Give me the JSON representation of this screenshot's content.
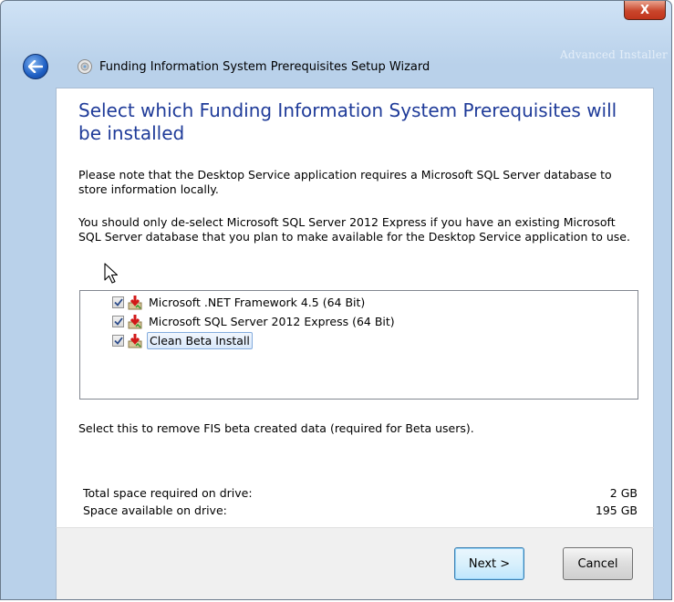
{
  "titlebar": {
    "close_glyph": "X",
    "brand_text": "Advanced Installer",
    "title": "Funding Information System Prerequisites Setup Wizard"
  },
  "icons": {
    "back": "back-arrow-icon",
    "wizard": "setup-wizard-icon",
    "close": "close-icon",
    "package": "install-package-icon",
    "checkbox": "checkbox-checked-icon",
    "cursor": "mouse-pointer-icon"
  },
  "page": {
    "heading": "Select which Funding Information System Prerequisites will be installed",
    "paragraph1": "Please note that the Desktop Service application requires a Microsoft SQL Server database to store information locally.",
    "paragraph2": "You should only de-select Microsoft SQL Server 2012 Express if you have an existing Microsoft SQL Server database that you plan to make available for the Desktop Service application to use.",
    "features": [
      {
        "label": "Microsoft .NET Framework 4.5 (64 Bit)",
        "checked": true
      },
      {
        "label": "Microsoft SQL Server 2012 Express (64 Bit)",
        "checked": true
      },
      {
        "label": "Clean Beta Install",
        "checked": true,
        "selected": true
      }
    ],
    "description": "Select this to remove FIS beta created data (required for Beta users).",
    "space": {
      "required_label": "Total space required on drive:",
      "required_value": "2 GB",
      "available_label": "Space available on drive:",
      "available_value": "195 GB"
    }
  },
  "footer": {
    "next_label": "Next >",
    "cancel_label": "Cancel"
  },
  "colors": {
    "heading": "#1f3b99",
    "chrome": "#b9d1ea",
    "close": "#c9462c"
  }
}
